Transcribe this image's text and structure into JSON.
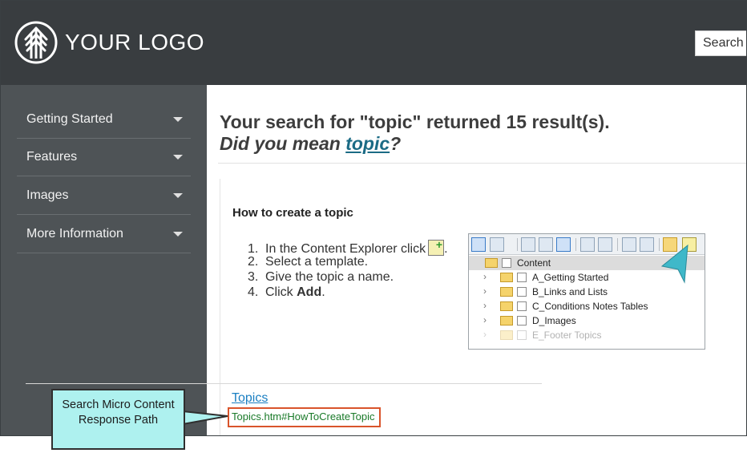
{
  "header": {
    "logo_text": "YOUR LOGO",
    "search_label": "Search"
  },
  "sidebar": {
    "items": [
      {
        "label": "Getting Started"
      },
      {
        "label": "Features"
      },
      {
        "label": "Images"
      },
      {
        "label": "More Information"
      }
    ]
  },
  "main": {
    "heading": "Your search for \"topic\" returned 15 result(s).",
    "did_you_mean_prefix": "Did you mean ",
    "did_you_mean_term": "topic",
    "did_you_mean_suffix": "?",
    "result": {
      "title": "How to create a topic",
      "steps": [
        {
          "num": "1.",
          "text": "In the Content Explorer click",
          "trailing": "."
        },
        {
          "num": "2.",
          "text": "Select a template."
        },
        {
          "num": "3.",
          "text": "Give the topic a name."
        },
        {
          "num": "4.",
          "text": "Click ",
          "bold": "Add",
          "trailing": "."
        }
      ],
      "explorer": {
        "root": "Content",
        "folders": [
          "A_Getting Started",
          "B_Links and Lists",
          "C_Conditions Notes Tables",
          "D_Images",
          "E_Footer Topics"
        ]
      },
      "link_text": "Topics",
      "path": "Topics.htm#HowToCreateTopic"
    }
  },
  "annotation": {
    "text": "Search Micro Content Response Path"
  },
  "colors": {
    "header_bg": "#393d40",
    "sidebar_bg": "#4e5356",
    "link": "#1a7fc2",
    "path_text": "#1a7a29",
    "highlight_border": "#d9542b",
    "callout_bg": "#aef1ef"
  },
  "icons": [
    "tree-logo-icon",
    "caret-down-icon",
    "add-topic-icon",
    "folder-icon",
    "checkbox-icon",
    "chevron-right-icon",
    "chevron-down-icon",
    "callout-arrow-icon"
  ]
}
